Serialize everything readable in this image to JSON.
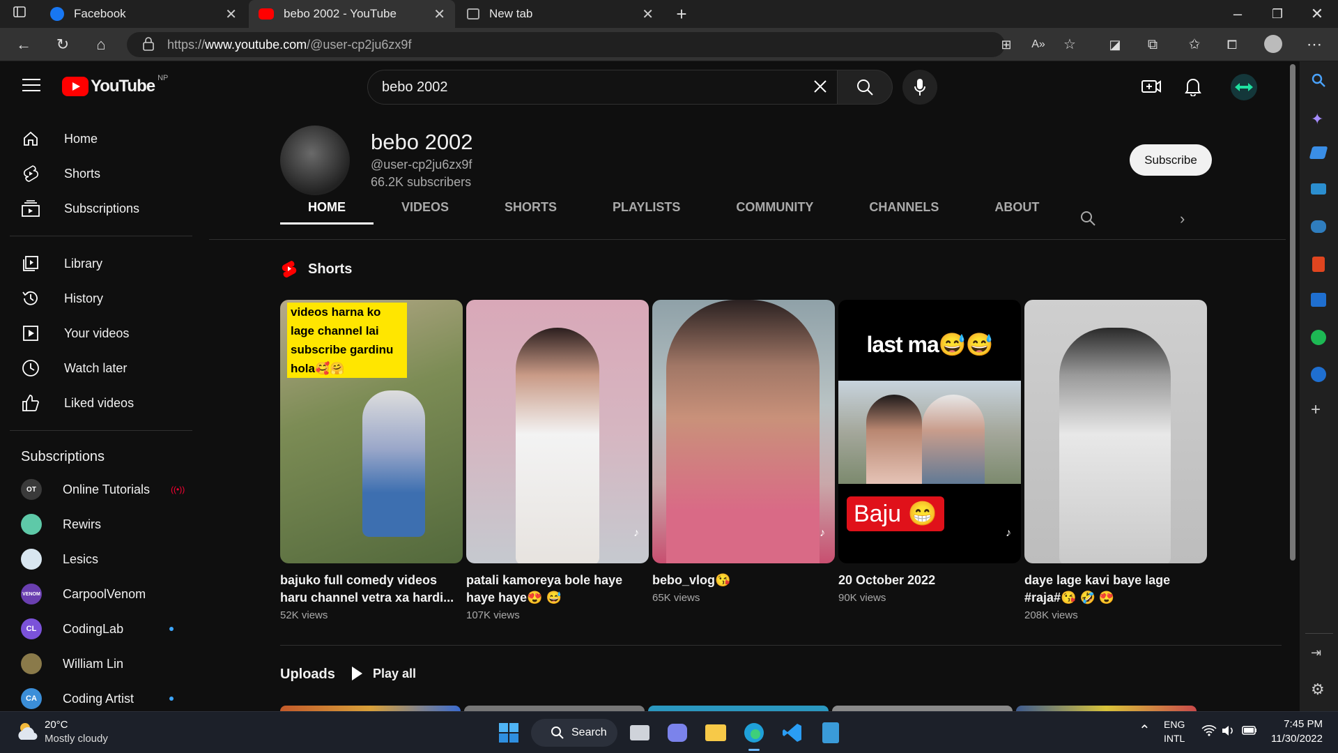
{
  "browser": {
    "tabs": [
      {
        "title": "Facebook"
      },
      {
        "title": "bebo 2002 - YouTube"
      },
      {
        "title": "New tab"
      }
    ],
    "url_prefix": "https://",
    "url_host": "www.youtube.com",
    "url_path": "/@user-cp2ju6zx9f"
  },
  "header": {
    "logo": "YouTube",
    "region": "NP",
    "search_value": "bebo 2002"
  },
  "sidebar": {
    "main": [
      {
        "label": "Home",
        "icon": "home-icon"
      },
      {
        "label": "Shorts",
        "icon": "shorts-icon"
      },
      {
        "label": "Subscriptions",
        "icon": "subscriptions-icon"
      }
    ],
    "library": [
      {
        "label": "Library",
        "icon": "library-icon"
      },
      {
        "label": "History",
        "icon": "history-icon"
      },
      {
        "label": "Your videos",
        "icon": "your-videos-icon"
      },
      {
        "label": "Watch later",
        "icon": "clock-icon"
      },
      {
        "label": "Liked videos",
        "icon": "thumbs-up-icon"
      }
    ],
    "subscriptions_title": "Subscriptions",
    "subscriptions": [
      {
        "label": "Online Tutorials",
        "abbr": "OT",
        "color": "#3a3a3a",
        "live": true
      },
      {
        "label": "Rewirs",
        "abbr": "",
        "color": "#5ec9a8"
      },
      {
        "label": "Lesics",
        "abbr": "",
        "color": "#d8e6f0"
      },
      {
        "label": "CarpoolVenom",
        "abbr": "VENOM",
        "color": "#6a3fb0"
      },
      {
        "label": "CodingLab",
        "abbr": "CL",
        "color": "#7b52d9",
        "dot": true
      },
      {
        "label": "William Lin",
        "abbr": "",
        "color": "#8a7a4a"
      },
      {
        "label": "Coding Artist",
        "abbr": "CA",
        "color": "#3b8ed8",
        "dot": true
      }
    ]
  },
  "channel": {
    "name": "bebo 2002",
    "handle": "@user-cp2ju6zx9f",
    "subscribers": "66.2K subscribers",
    "subscribe_label": "Subscribe",
    "tabs": [
      "HOME",
      "VIDEOS",
      "SHORTS",
      "PLAYLISTS",
      "COMMUNITY",
      "CHANNELS",
      "ABOUT"
    ],
    "shorts_title": "Shorts",
    "shorts": [
      {
        "title": "bajuko full comedy videos haru channel vetra xa hardi...",
        "views": "52K views",
        "caption": "videos harna ko lage channel lai subscribe gardinu hola🥰🤗"
      },
      {
        "title": "patali kamoreya bole haye haye haye😍 😅",
        "views": "107K views"
      },
      {
        "title": "bebo_vlog😘",
        "views": "65K views"
      },
      {
        "title": "20 October 2022",
        "views": "90K views",
        "caption_top": "last ma😅😅",
        "caption_bottom": "Baju 😁"
      },
      {
        "title": "daye lage kavi baye lage #raja#😘 🤣 😍",
        "views": "208K views"
      }
    ],
    "uploads_title": "Uploads",
    "play_all": "Play all"
  },
  "taskbar": {
    "temp": "20°C",
    "weather": "Mostly cloudy",
    "search_label": "Search",
    "lang1": "ENG",
    "lang2": "INTL",
    "time": "7:45 PM",
    "date": "11/30/2022"
  }
}
